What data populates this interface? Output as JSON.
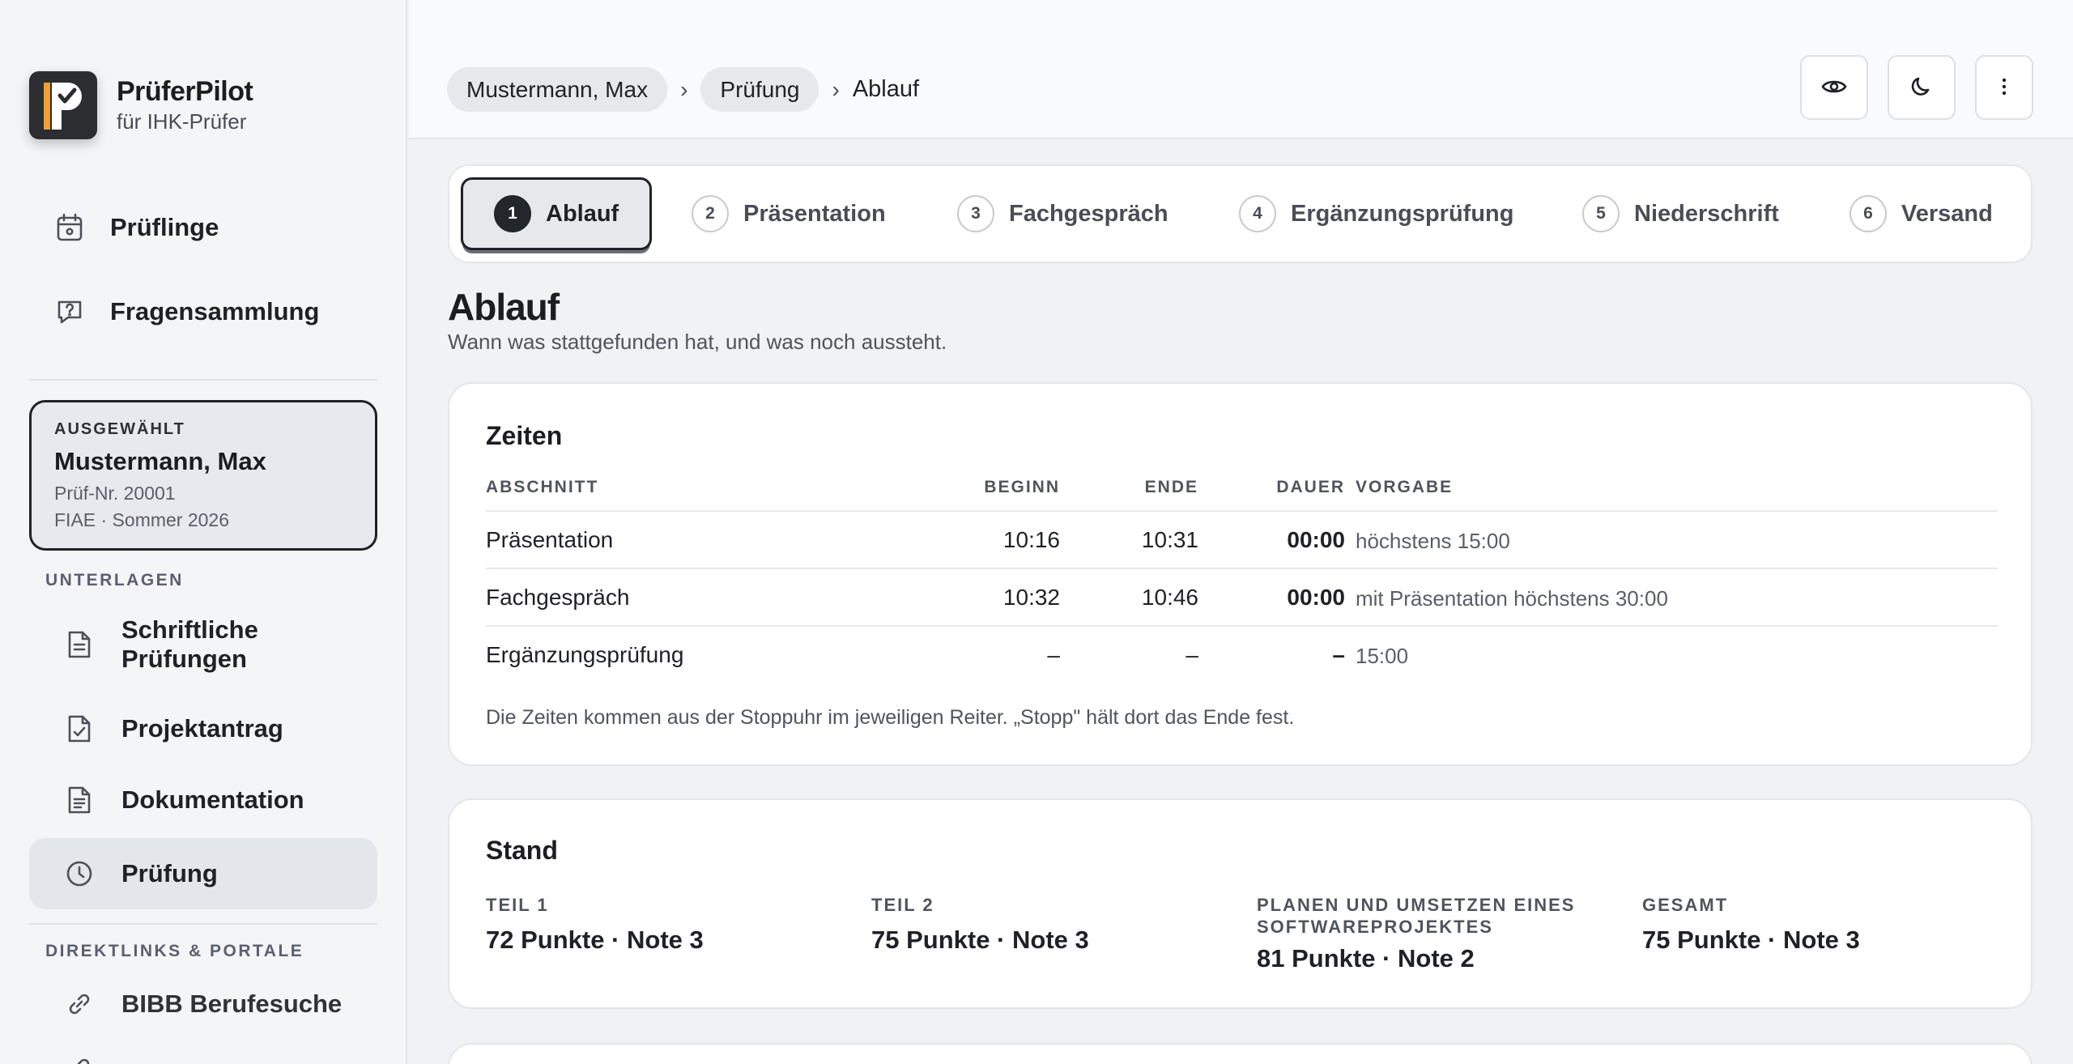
{
  "brand": {
    "name": "PrüferPilot",
    "subtitle": "für IHK-Prüfer"
  },
  "nav_top": [
    {
      "label": "Prüflinge",
      "icon": "calendar-icon"
    },
    {
      "label": "Fragensammlung",
      "icon": "question-bubble-icon"
    }
  ],
  "selected": {
    "kicker": "AUSGEWÄHLT",
    "name": "Mustermann, Max",
    "exam_no": "Prüf-Nr. 20001",
    "term": "FIAE · Sommer 2026"
  },
  "sections": {
    "unterlagen": "UNTERLAGEN",
    "links": "DIREKTLINKS & PORTALE"
  },
  "nav_docs": [
    {
      "label": "Schriftliche Prüfungen",
      "icon": "document-icon"
    },
    {
      "label": "Projektantrag",
      "icon": "document-check-icon"
    },
    {
      "label": "Dokumentation",
      "icon": "document-lines-icon"
    },
    {
      "label": "Prüfung",
      "icon": "clock-icon",
      "active": true
    }
  ],
  "nav_links": [
    {
      "label": "BIBB Berufesuche",
      "icon": "link-icon"
    }
  ],
  "breadcrumb": {
    "item1": "Mustermann, Max",
    "item2": "Prüfung",
    "current": "Ablauf",
    "separator": "›"
  },
  "header_buttons": [
    "eye-icon",
    "moon-icon",
    "more-vertical-icon"
  ],
  "steps": [
    {
      "num": "1",
      "label": "Ablauf",
      "active": true
    },
    {
      "num": "2",
      "label": "Präsentation"
    },
    {
      "num": "3",
      "label": "Fachgespräch"
    },
    {
      "num": "4",
      "label": "Ergänzungsprüfung"
    },
    {
      "num": "5",
      "label": "Niederschrift"
    },
    {
      "num": "6",
      "label": "Versand"
    }
  ],
  "page": {
    "title": "Ablauf",
    "subtitle": "Wann was stattgefunden hat, und was noch aussteht."
  },
  "zeiten": {
    "title": "Zeiten",
    "headers": {
      "abschnitt": "ABSCHNITT",
      "beginn": "BEGINN",
      "ende": "ENDE",
      "dauer": "DAUER",
      "vorgabe": "VORGABE"
    },
    "rows": [
      {
        "abschnitt": "Präsentation",
        "beginn": "10:16",
        "ende": "10:31",
        "dauer": "00:00",
        "vorgabe": "höchstens 15:00"
      },
      {
        "abschnitt": "Fachgespräch",
        "beginn": "10:32",
        "ende": "10:46",
        "dauer": "00:00",
        "vorgabe": "mit Präsentation höchstens 30:00"
      },
      {
        "abschnitt": "Ergänzungsprüfung",
        "beginn": "–",
        "ende": "–",
        "dauer": "–",
        "vorgabe": "15:00"
      }
    ],
    "note": "Die Zeiten kommen aus der Stoppuhr im jeweiligen Reiter. „Stopp\" hält dort das Ende fest."
  },
  "stand": {
    "title": "Stand",
    "items": [
      {
        "label": "TEIL 1",
        "value": "72 Punkte · Note 3"
      },
      {
        "label": "TEIL 2",
        "value": "75 Punkte · Note 3"
      },
      {
        "label": "PLANEN UND UMSETZEN EINES SOFTWAREPROJEKTES",
        "value": "81 Punkte · Note 2"
      },
      {
        "label": "GESAMT",
        "value": "75 Punkte · Note 3"
      }
    ]
  },
  "colors": {
    "accent_orange": "#f0a030",
    "dark": "#23262b",
    "sidebar_bg": "#f4f5f7",
    "page_bg": "#f1f2f4"
  }
}
